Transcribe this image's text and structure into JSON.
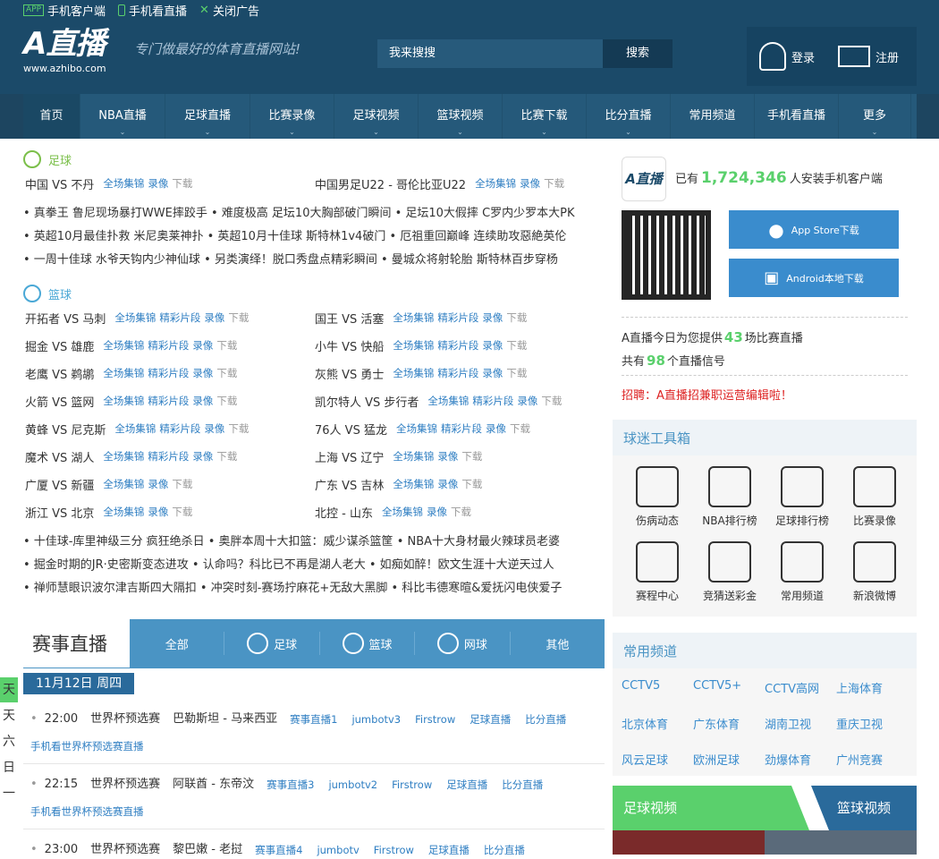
{
  "topbar": {
    "client": "手机客户端",
    "watch": "手机看直播",
    "close_ad": "关闭广告",
    "app_tag": "APP",
    "logo": "A直播",
    "logo_url": "www.azhibo.com",
    "slogan": "专门做最好的体育直播网站!",
    "search_placeholder": "我来搜搜",
    "search_btn": "搜索",
    "login": "登录",
    "register": "注册"
  },
  "nav": [
    "首页",
    "NBA直播",
    "足球直播",
    "比赛录像",
    "足球视频",
    "篮球视频",
    "比赛下载",
    "比分直播",
    "常用频道",
    "手机看直播",
    "更多"
  ],
  "football": {
    "title": "足球",
    "matches": [
      {
        "t": "中国 VS 不丹",
        "links": [
          "全场集锦",
          "录像"
        ],
        "dl": "下载"
      },
      {
        "t": "中国男足U22 - 哥伦比亚U22",
        "links": [
          "全场集锦",
          "录像"
        ],
        "dl": "下载"
      }
    ],
    "news": [
      "• 真拳王 鲁尼现场暴打WWE摔跤手 • 难度极高 足坛10大胸部破门瞬间 • 足坛10大假摔 C罗内少罗本大PK",
      "• 英超10月最佳扑救 米尼奥莱神扑 • 英超10月十佳球 斯特林1v4破门 • 厄祖重回巅峰 连续助攻惡絶英伦",
      "• 一周十佳球 水爷天钩内少神仙球 • 另类演绎！脱口秀盘点精彩瞬间 • 曼城众将射轮胎 斯特林百步穿杨"
    ]
  },
  "basketball": {
    "title": "篮球",
    "matches": [
      {
        "t": "开拓者 VS 马刺",
        "links": [
          "全场集锦",
          "精彩片段",
          "录像"
        ],
        "dl": "下载"
      },
      {
        "t": "国王 VS 活塞",
        "links": [
          "全场集锦",
          "精彩片段",
          "录像"
        ],
        "dl": "下载"
      },
      {
        "t": "掘金 VS 雄鹿",
        "links": [
          "全场集锦",
          "精彩片段",
          "录像"
        ],
        "dl": "下载"
      },
      {
        "t": "小牛 VS 快船",
        "links": [
          "全场集锦",
          "精彩片段",
          "录像"
        ],
        "dl": "下载"
      },
      {
        "t": "老鹰 VS 鹈鹕",
        "links": [
          "全场集锦",
          "精彩片段",
          "录像"
        ],
        "dl": "下载"
      },
      {
        "t": "灰熊 VS 勇士",
        "links": [
          "全场集锦",
          "精彩片段",
          "录像"
        ],
        "dl": "下载"
      },
      {
        "t": "火箭 VS 篮网",
        "links": [
          "全场集锦",
          "精彩片段",
          "录像"
        ],
        "dl": "下载"
      },
      {
        "t": "凯尔特人 VS 步行者",
        "links": [
          "全场集锦",
          "精彩片段",
          "录像"
        ],
        "dl": "下载"
      },
      {
        "t": "黄蜂 VS 尼克斯",
        "links": [
          "全场集锦",
          "精彩片段",
          "录像"
        ],
        "dl": "下载"
      },
      {
        "t": "76人 VS 猛龙",
        "links": [
          "全场集锦",
          "精彩片段",
          "录像"
        ],
        "dl": "下载"
      },
      {
        "t": "魔术 VS 湖人",
        "links": [
          "全场集锦",
          "精彩片段",
          "录像"
        ],
        "dl": "下载"
      },
      {
        "t": "上海 VS 辽宁",
        "links": [
          "全场集锦",
          "录像"
        ],
        "dl": "下载"
      },
      {
        "t": "广厦 VS 新疆",
        "links": [
          "全场集锦",
          "录像"
        ],
        "dl": "下载"
      },
      {
        "t": "广东 VS 吉林",
        "links": [
          "全场集锦",
          "录像"
        ],
        "dl": "下载"
      },
      {
        "t": "浙江 VS 北京",
        "links": [
          "全场集锦",
          "录像"
        ],
        "dl": "下载"
      },
      {
        "t": "北控 - 山东",
        "links": [
          "全场集锦",
          "录像"
        ],
        "dl": "下载"
      }
    ],
    "news": [
      "• 十佳球-库里神级三分 疯狂绝杀日 • 奥胖本周十大扣篮：威少谋杀篮筐 • NBA十大身材最火辣球员老婆",
      "• 掘金时期的JR·史密斯变态进攻 • 认命吗？科比已不再是湖人老大 • 如痴如醉！欧文生涯十大逆天过人",
      "• 禅师慧眼识波尔津吉斯四大隔扣 • 冲突时刻-赛场拧麻花+无敌大黑脚 • 科比韦德寒暄&爱抚闪电侠爱子"
    ]
  },
  "live": {
    "title": "赛事直播",
    "tabs": [
      "全部",
      "足球",
      "篮球",
      "网球",
      "其他"
    ],
    "date": "11月12日 周四",
    "days": [
      "天",
      "天",
      "六",
      "日",
      "一"
    ],
    "games": [
      {
        "time": "22:00",
        "league": "世界杯预选赛",
        "match": "巴勒斯坦 - 马来西亚",
        "links": [
          "赛事直播1",
          "jumbotv3",
          "Firstrow",
          "足球直播",
          "比分直播"
        ],
        "sub": "手机看世界杯预选赛直播"
      },
      {
        "time": "22:15",
        "league": "世界杯预选赛",
        "match": "阿联酋 - 东帝汶",
        "links": [
          "赛事直播3",
          "jumbotv2",
          "Firstrow",
          "足球直播",
          "比分直播"
        ],
        "sub": "手机看世界杯预选赛直播"
      },
      {
        "time": "23:00",
        "league": "世界杯预选赛",
        "match": "黎巴嫩 - 老挝",
        "links": [
          "赛事直播4",
          "jumbotv",
          "Firstrow",
          "足球直播",
          "比分直播"
        ],
        "sub": ""
      }
    ]
  },
  "app": {
    "count_prefix": "已有",
    "count": "1,724,346",
    "count_suffix": "人安装手机客户端",
    "appstore": "App Store下载",
    "android": "Android本地下载",
    "today_prefix": "A直播今日为您提供",
    "today_num": "43",
    "today_suffix": "场比赛直播",
    "signal_prefix": "共有",
    "signal_num": "98",
    "signal_suffix": "个直播信号",
    "hire": "招聘：A直播招兼职运营编辑啦！"
  },
  "tools": {
    "title": "球迷工具箱",
    "items": [
      "伤病动态",
      "NBA排行榜",
      "足球排行榜",
      "比赛录像",
      "赛程中心",
      "竞猜送彩金",
      "常用频道",
      "新浪微博"
    ]
  },
  "channels": {
    "title": "常用频道",
    "items": [
      "CCTV5",
      "CCTV5+",
      "CCTV高网",
      "上海体育",
      "北京体育",
      "广东体育",
      "湖南卫视",
      "重庆卫视",
      "风云足球",
      "欧洲足球",
      "劲爆体育",
      "广州竞赛"
    ]
  },
  "video": {
    "left": "足球视频",
    "right": "篮球视频"
  },
  "colors": {
    "brand": "#1b4a69",
    "accent": "#4a94c4",
    "green": "#5ad06c"
  }
}
